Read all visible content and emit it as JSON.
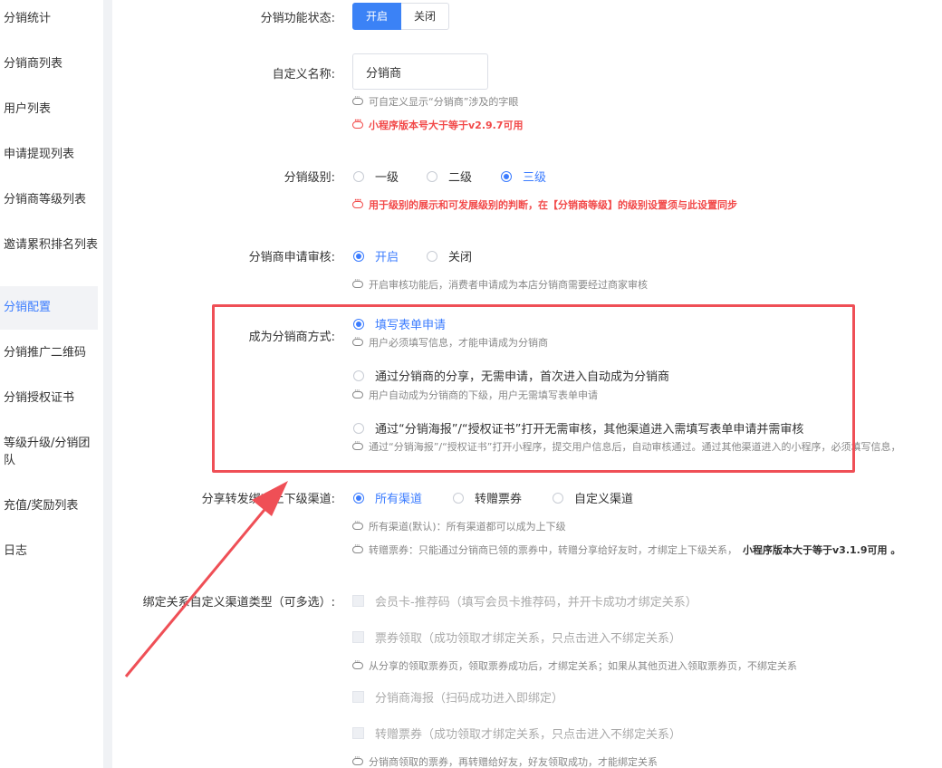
{
  "sidebar": {
    "items": [
      {
        "label": "分销统计"
      },
      {
        "label": "分销商列表"
      },
      {
        "label": "用户列表"
      },
      {
        "label": "申请提现列表"
      },
      {
        "label": "分销商等级列表"
      },
      {
        "label": "邀请累积排名列表"
      },
      {
        "label": "分销配置"
      },
      {
        "label": "分销推广二维码"
      },
      {
        "label": "分销授权证书"
      },
      {
        "label": "等级升级/分销团队"
      },
      {
        "label": "充值/奖励列表"
      },
      {
        "label": "日志"
      }
    ],
    "active": "分销配置"
  },
  "form": {
    "status": {
      "label": "分销功能状态:",
      "on": "开启",
      "off": "关闭",
      "selected": "开启"
    },
    "custom_name": {
      "label": "自定义名称:",
      "value": "分销商",
      "hint": "可自定义显示“分销商”涉及的字眼",
      "hint_red": "小程序版本号大于等于v2.9.7可用"
    },
    "level": {
      "label": "分销级别:",
      "options": [
        "一级",
        "二级",
        "三级"
      ],
      "selected": "三级",
      "hint_red": "用于级别的展示和可发展级别的判断，在【分销商等级】的级别设置须与此设置同步"
    },
    "audit": {
      "label": "分销商申请审核:",
      "options": [
        "开启",
        "关闭"
      ],
      "selected": "开启",
      "hint": "开启审核功能后，消费者申请成为本店分销商需要经过商家审核"
    },
    "become": {
      "label": "成为分销商方式:",
      "options": [
        {
          "label": "填写表单申请",
          "hint": "用户必须填写信息，才能申请成为分销商"
        },
        {
          "label": "通过分销商的分享，无需申请，首次进入自动成为分销商",
          "hint": "用户自动成为分销商的下级，用户无需填写表单申请"
        },
        {
          "label": "通过“分销海报”/“授权证书”打开无需审核，其他渠道进入需填写表单申请并需审核",
          "hint": "通过“分销海报”/“授权证书”打开小程序，提交用户信息后，自动审核通过。通过其他渠道进入的小程序，必须填写信息，"
        }
      ],
      "selected": "填写表单申请"
    },
    "channel": {
      "label": "分享转发绑定上下级渠道:",
      "options": [
        "所有渠道",
        "转赠票券",
        "自定义渠道"
      ],
      "selected": "所有渠道",
      "hint1": "所有渠道(默认)：所有渠道都可以成为上下级",
      "hint2": "转赠票券：只能通过分销商已领的票券中，转赠分享给好友时，才绑定上下级关系，",
      "hint2_bold": "小程序版本大于等于v3.1.9可用 。"
    },
    "bind": {
      "label": "绑定关系自定义渠道类型（可多选）:",
      "options": [
        {
          "label": "会员卡-推荐码（填写会员卡推荐码，并开卡成功才绑定关系）"
        },
        {
          "label": "票券领取（成功领取才绑定关系，只点击进入不绑定关系）",
          "hint": "从分享的领取票券页，领取票券成功后，才绑定关系；如果从其他页进入领取票券页，不绑定关系"
        },
        {
          "label": "分销商海报（扫码成功进入即绑定）"
        },
        {
          "label": "转赠票券（成功领取才绑定关系，只点击进入不绑定关系）",
          "hint": "分销商领取的票券，再转赠给好友，好友领取成功，才能绑定关系"
        }
      ]
    }
  },
  "colors": {
    "primary": "#3b7cff",
    "danger": "#f24a4a",
    "annotation": "#ef4f56"
  }
}
